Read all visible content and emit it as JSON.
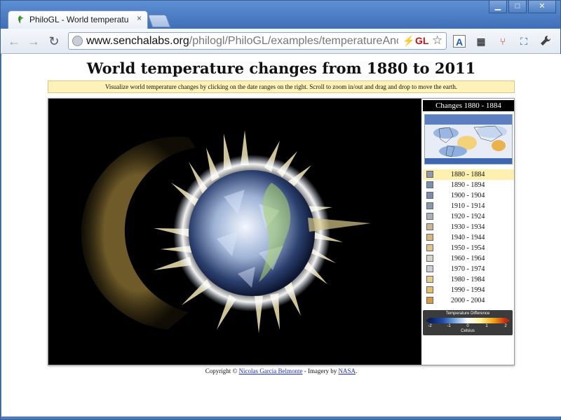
{
  "browser": {
    "tab_title": "PhiloGL - World temperatu",
    "tab_close": "×",
    "window_controls": {
      "minimize": "▁",
      "maximize": "□",
      "close": "✕"
    },
    "nav": {
      "back": "←",
      "forward": "→",
      "reload": "↻"
    },
    "url_host": "www.senchalabs.org",
    "url_path": "/philogl/PhiloGL/examples/temperatureAnoma",
    "omnibox_icons": {
      "bolt": "⚡",
      "gl": "GL",
      "star": "☆"
    },
    "extension_icons": [
      "translate-icon",
      "qr-code-icon",
      "share-icon",
      "fullscreen-icon",
      "wrench-icon"
    ],
    "extension_glyphs": [
      "A",
      "▦",
      "⑂",
      "⛶",
      "🔧"
    ]
  },
  "page": {
    "title": "World temperature changes from 1880 to 2011",
    "info": "Visualize world temperature changes by clicking on the date ranges on the right. Scroll to zoom in/out and drag and drop to move the earth."
  },
  "sidebar": {
    "header": "Changes 1880 - 1884",
    "selected_index": 0,
    "items": [
      {
        "label": "1880 - 1884",
        "color": "#8f98a8"
      },
      {
        "label": "1890 - 1894",
        "color": "#7b8fae"
      },
      {
        "label": "1900 - 1904",
        "color": "#7c8cb0"
      },
      {
        "label": "1910 - 1914",
        "color": "#8896ae"
      },
      {
        "label": "1920 - 1924",
        "color": "#aab0b8"
      },
      {
        "label": "1930 - 1934",
        "color": "#c8b896"
      },
      {
        "label": "1940 - 1944",
        "color": "#d8b87a"
      },
      {
        "label": "1950 - 1954",
        "color": "#e0c48a"
      },
      {
        "label": "1960 - 1964",
        "color": "#d8d4c8"
      },
      {
        "label": "1970 - 1974",
        "color": "#cdcfd0"
      },
      {
        "label": "1980 - 1984",
        "color": "#e6cc8c"
      },
      {
        "label": "1990 - 1994",
        "color": "#e3c068"
      },
      {
        "label": "2000 - 2004",
        "color": "#d89a3a"
      }
    ],
    "legend": {
      "title": "Temperature Difference",
      "ticks": [
        "-2",
        "-1",
        "0",
        "1",
        "2"
      ],
      "unit": "Celsius"
    }
  },
  "footer": {
    "copyright_prefix": "Copyright © ",
    "author": "Nicolas Garcia Belmonte",
    "imagery_prefix": " - Imagery by ",
    "imagery_source": "NASA",
    "suffix": "."
  }
}
